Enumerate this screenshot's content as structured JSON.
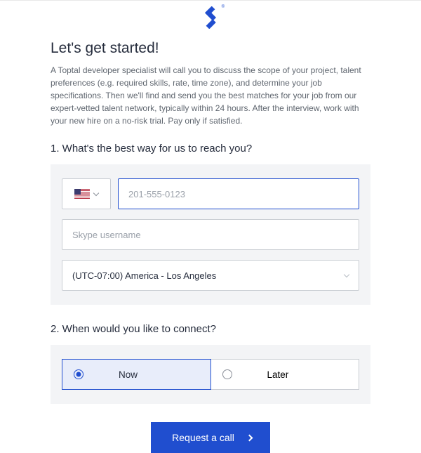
{
  "brand": {
    "name": "Toptal"
  },
  "heading": "Let's get started!",
  "description": "A Toptal developer specialist will call you to discuss the scope of your project, talent preferences (e.g. required skills, rate, time zone), and determine your job specifications. Then we'll find and send you the best matches for your job from our expert-vetted talent network, typically within 24 hours. After the interview, work with your new hire on a no-risk trial. Pay only if satisfied.",
  "sections": {
    "contact": {
      "label": "1. What's the best way for us to reach you?",
      "country": {
        "code": "US",
        "flag": "us"
      },
      "phone": {
        "value": "",
        "placeholder": "201-555-0123"
      },
      "skype": {
        "value": "",
        "placeholder": "Skype username"
      },
      "timezone": {
        "selected": "(UTC-07:00) America - Los Angeles"
      }
    },
    "schedule": {
      "label": "2. When would you like to connect?",
      "options": {
        "now": "Now",
        "later": "Later"
      },
      "selected": "now"
    }
  },
  "cta": {
    "label": "Request a call"
  },
  "colors": {
    "accent": "#204ecf",
    "panel": "#f3f4f6",
    "border": "#c9cdd3",
    "text": "#262d3d",
    "muted": "#606770"
  }
}
